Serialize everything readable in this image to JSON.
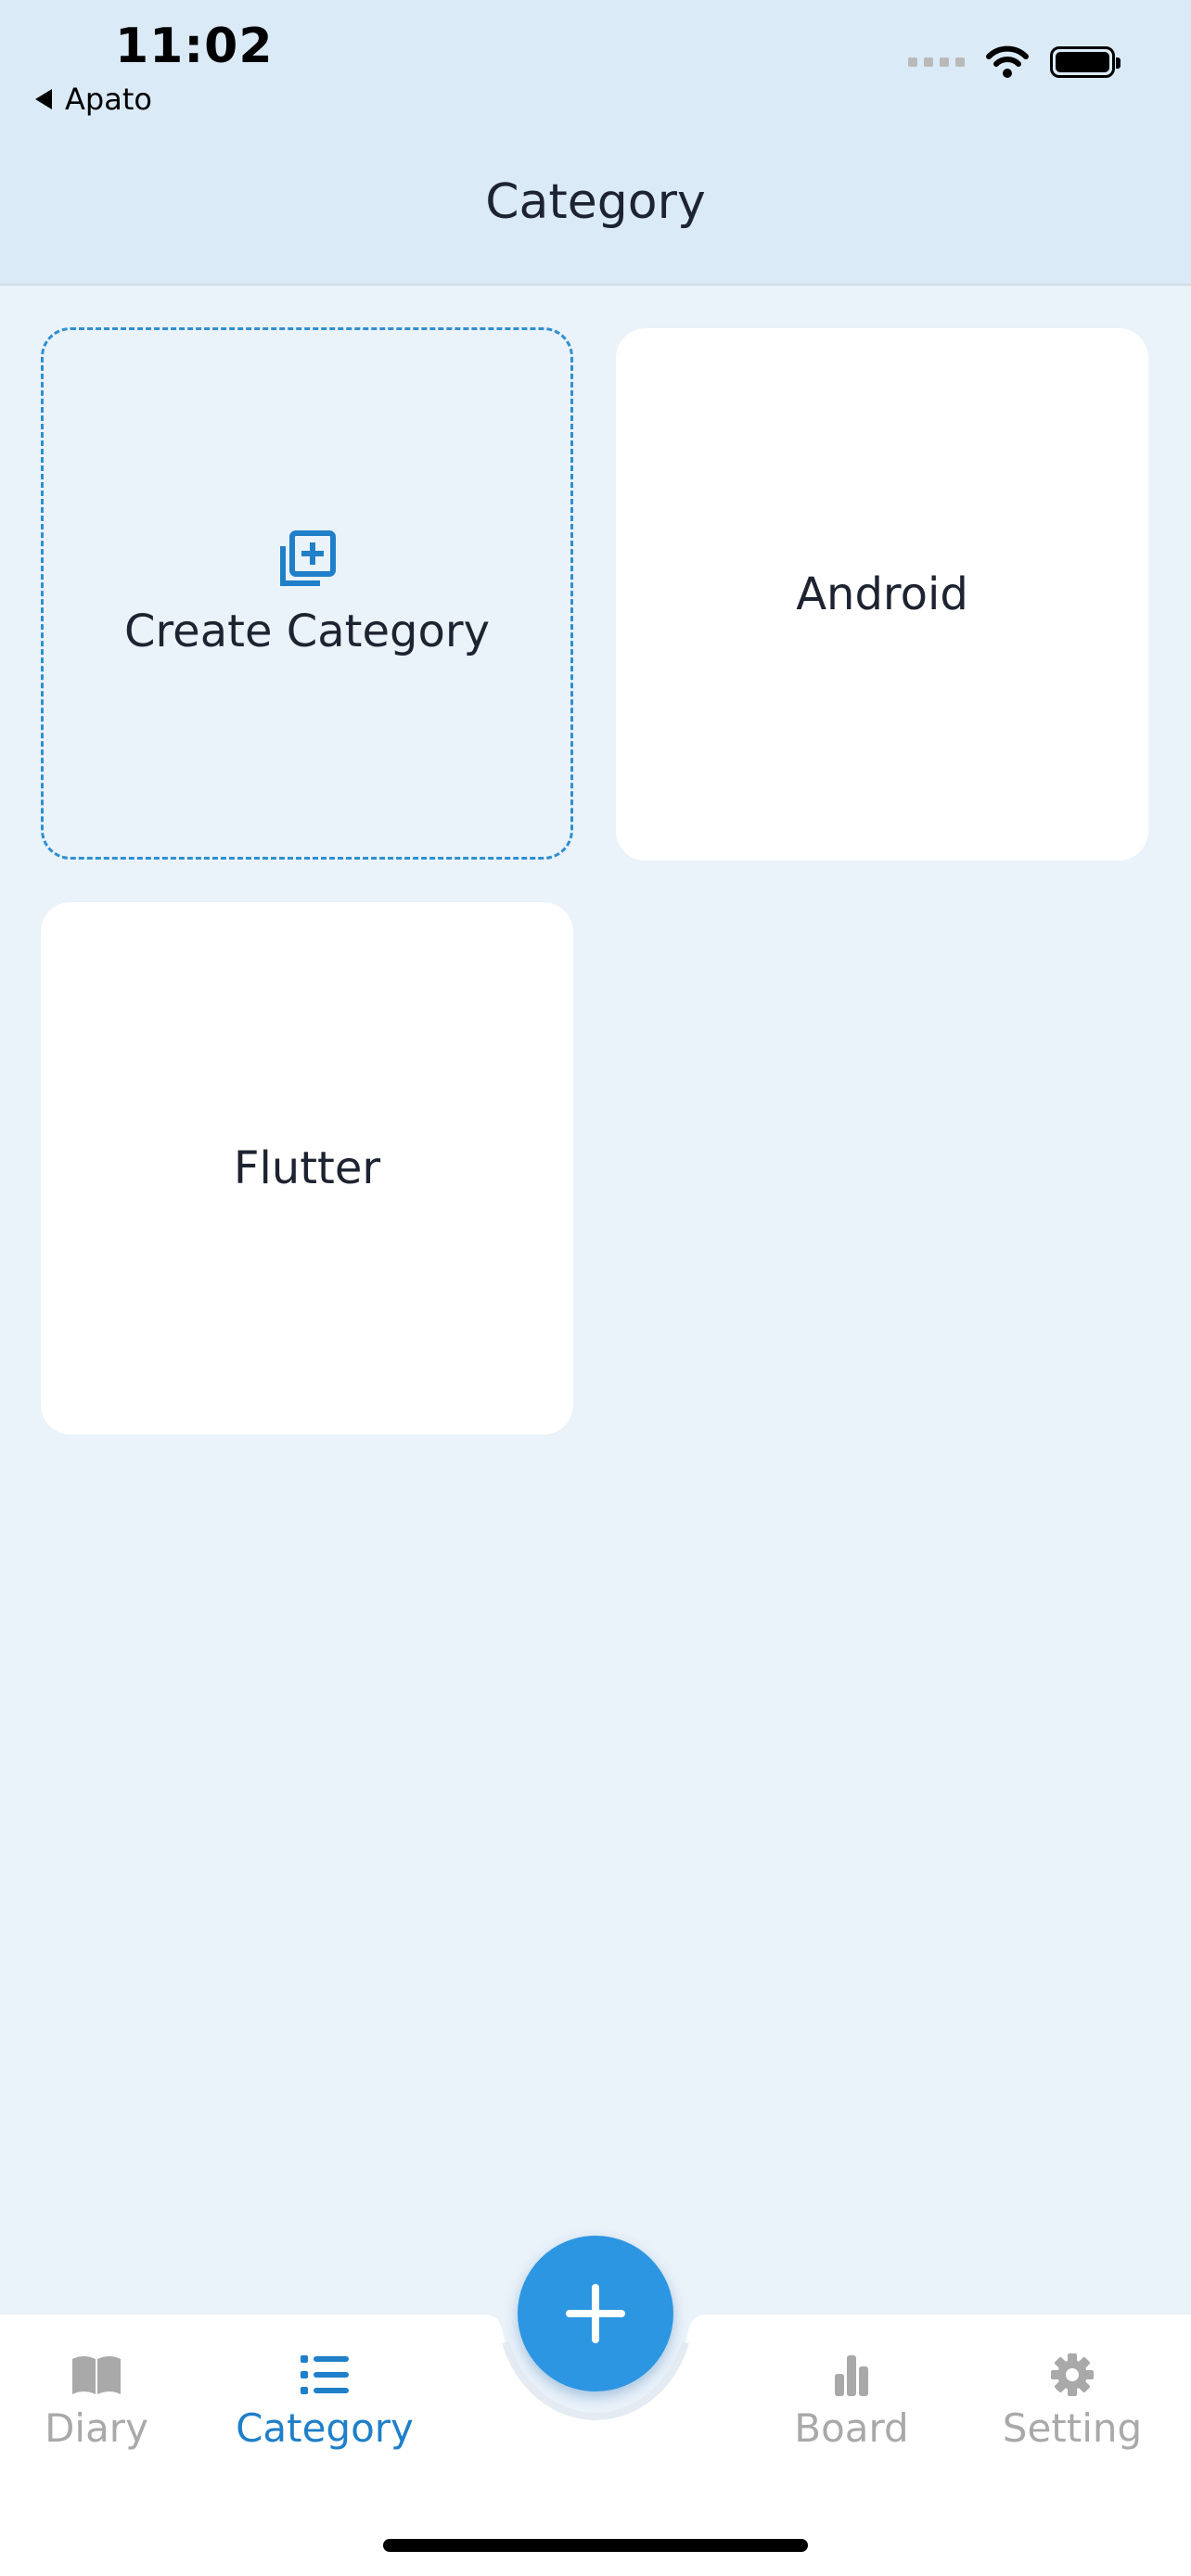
{
  "status_bar": {
    "time": "11:02",
    "back_app": "Apato"
  },
  "header": {
    "title": "Category"
  },
  "categories": {
    "create_label": "Create Category",
    "items": [
      {
        "label": "Android"
      },
      {
        "label": "Flutter"
      }
    ]
  },
  "tabbar": {
    "tabs": [
      {
        "label": "Diary",
        "icon": "book-icon",
        "active": false
      },
      {
        "label": "Category",
        "icon": "list-icon",
        "active": true
      },
      {
        "label": "Board",
        "icon": "bar-chart-icon",
        "active": false
      },
      {
        "label": "Setting",
        "icon": "gear-icon",
        "active": false
      }
    ],
    "fab_icon": "plus-icon"
  },
  "colors": {
    "accent": "#2d96e2",
    "active_tab": "#1f7fc8",
    "inactive_tab": "#a9a9a9",
    "background": "#eaf2fa",
    "header": "#dbeaf7"
  }
}
